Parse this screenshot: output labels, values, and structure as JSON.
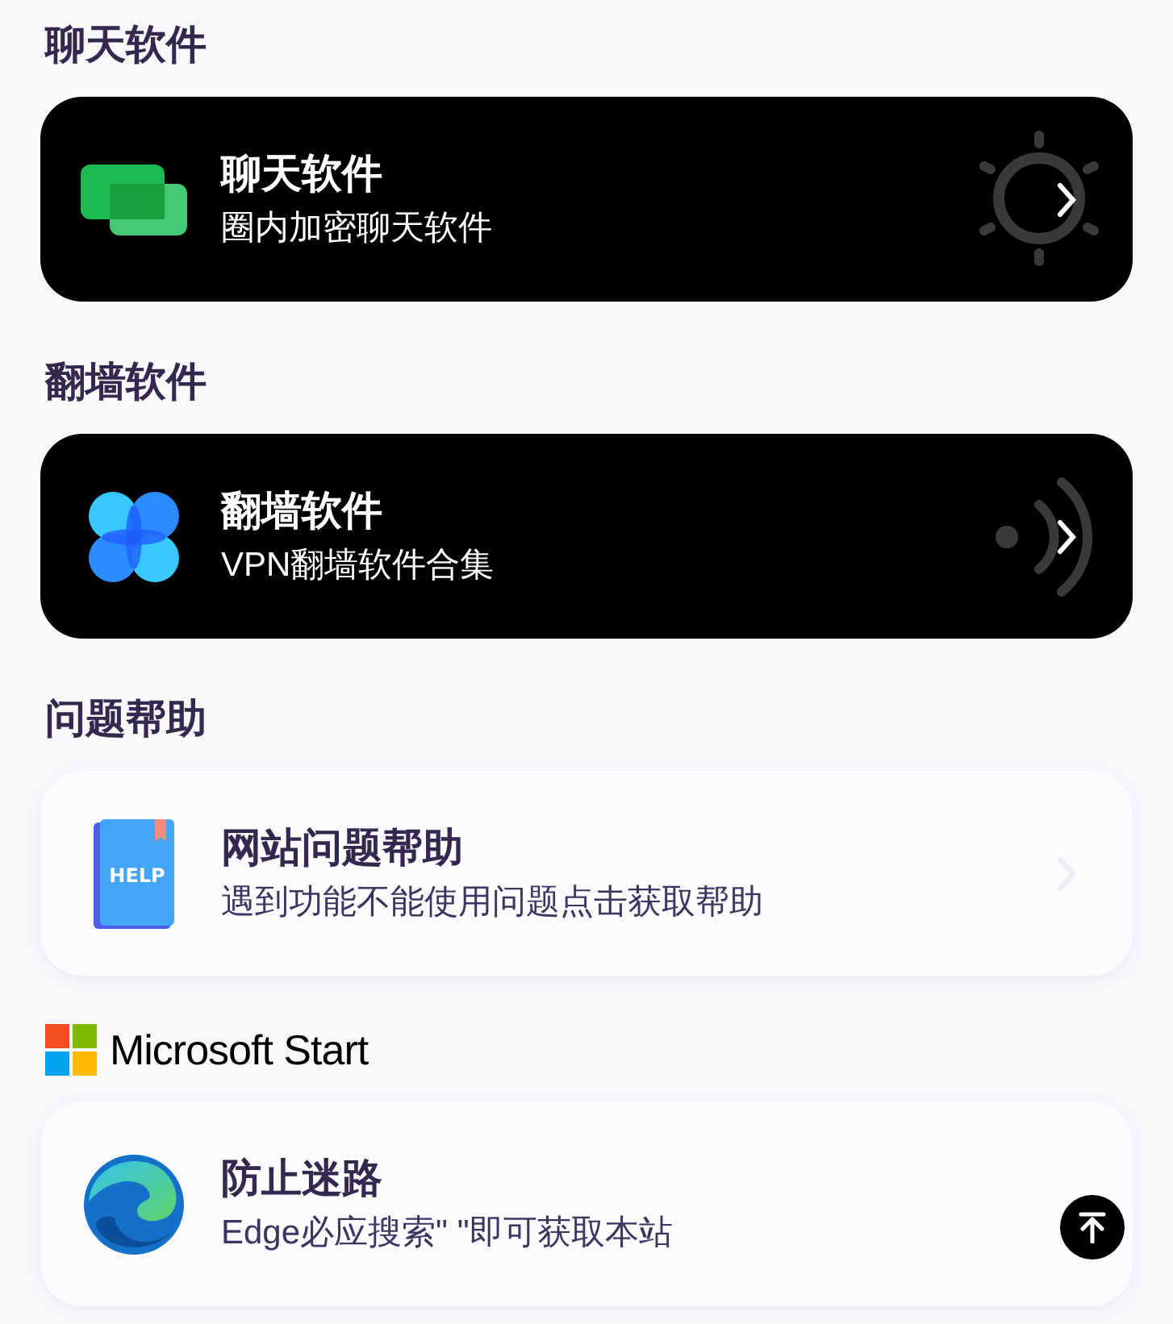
{
  "sections": [
    {
      "heading": {
        "kind": "text",
        "text": "聊天软件"
      },
      "card": {
        "title": "聊天软件",
        "subtitle": "圈内加密聊天软件"
      }
    },
    {
      "heading": {
        "kind": "text",
        "text": "翻墙软件"
      },
      "card": {
        "title": "翻墙软件",
        "subtitle": "VPN翻墙软件合集"
      }
    },
    {
      "heading": {
        "kind": "text",
        "text": "问题帮助"
      },
      "card": {
        "icon_text": "HELP",
        "title": "网站问题帮助",
        "subtitle": "遇到功能不能使用问题点击获取帮助"
      }
    },
    {
      "heading": {
        "kind": "logo",
        "text": "Microsoft Start"
      },
      "card": {
        "title": "防止迷路",
        "subtitle": "Edge必应搜索\" \"即可获取本站"
      }
    }
  ]
}
